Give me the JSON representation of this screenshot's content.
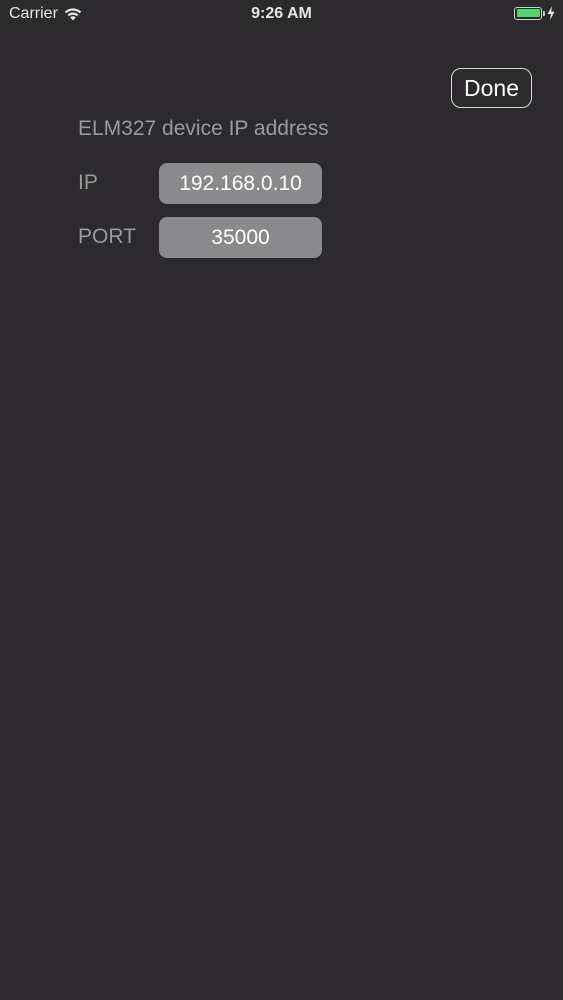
{
  "status_bar": {
    "carrier": "Carrier",
    "time": "9:26 AM",
    "battery_color": "#4cd964",
    "wifi_icon": "wifi-icon",
    "charge_icon": "charging-bolt-icon"
  },
  "toolbar": {
    "done_label": "Done"
  },
  "form": {
    "title": "ELM327 device IP address",
    "ip_label": "IP",
    "ip_value": "192.168.0.10",
    "port_label": "PORT",
    "port_value": "35000"
  },
  "colors": {
    "background": "#2c2a2d",
    "field_background": "#8a898b",
    "label_text": "#9b9a9c"
  }
}
